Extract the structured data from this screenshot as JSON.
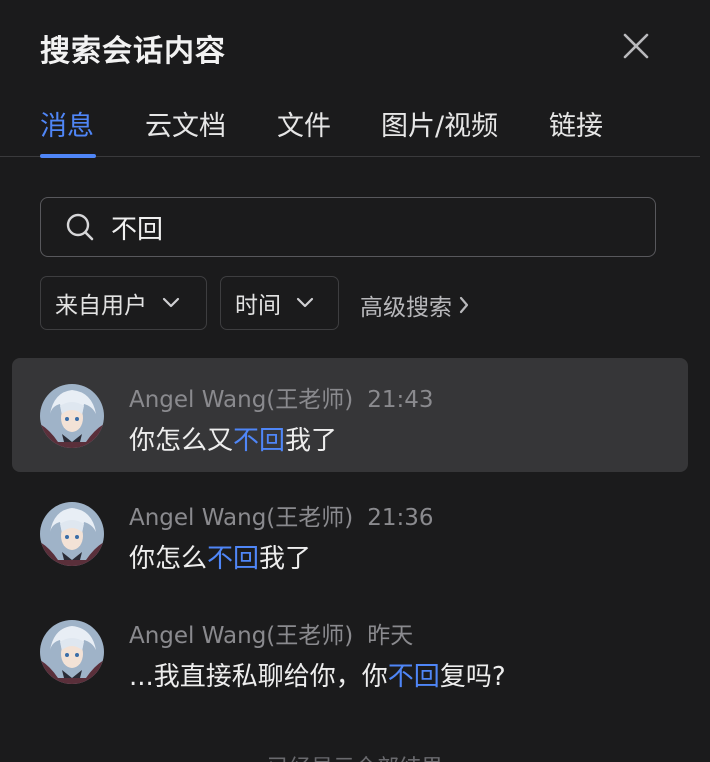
{
  "dialog": {
    "title": "搜索会话内容"
  },
  "tabs": [
    {
      "label": "消息",
      "active": true
    },
    {
      "label": "云文档"
    },
    {
      "label": "文件"
    },
    {
      "label": "图片/视频"
    },
    {
      "label": "链接"
    }
  ],
  "search": {
    "value": "不回"
  },
  "filters": {
    "from_user": "来自用户",
    "time": "时间",
    "advanced": "高级搜索"
  },
  "results": [
    {
      "sender": "Angel Wang(王老师)",
      "time": "21:43",
      "text_before": "你怎么又",
      "highlight": "不回",
      "text_after": "我了",
      "selected": true
    },
    {
      "sender": "Angel Wang(王老师)",
      "time": "21:36",
      "text_before": "你怎么",
      "highlight": "不回",
      "text_after": "我了"
    },
    {
      "sender": "Angel Wang(王老师)",
      "time": "昨天",
      "text_before": "...我直接私聊给你，你",
      "highlight": "不回",
      "text_after": "复吗?"
    }
  ],
  "footer": {
    "hint": "已经显示全部结果"
  },
  "colors": {
    "background": "#1b1b1c",
    "accent": "#4f86f7",
    "selected_row": "#363638"
  }
}
